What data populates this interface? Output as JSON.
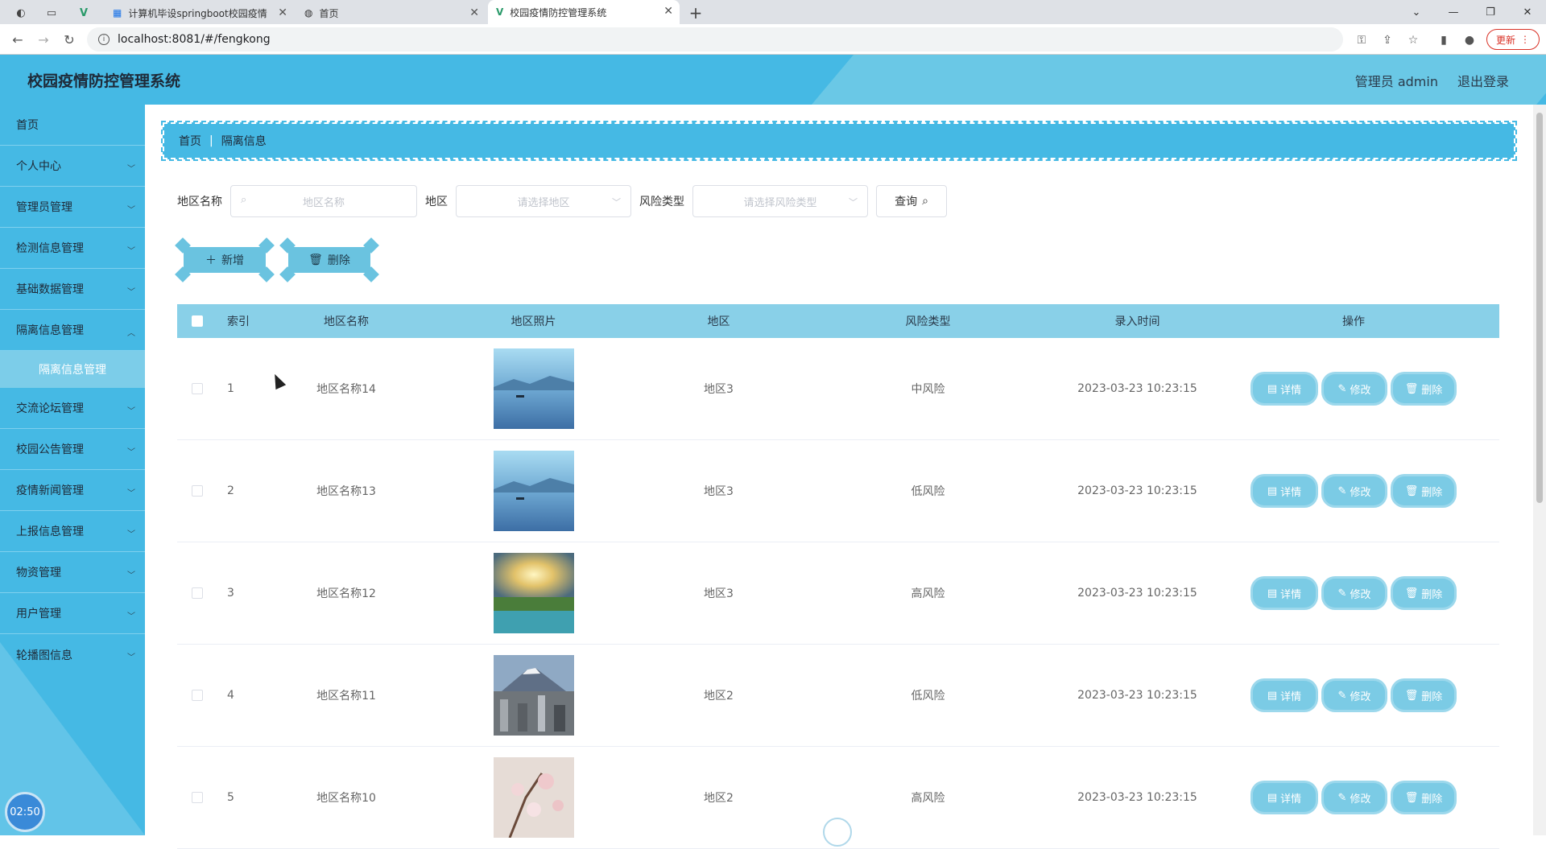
{
  "browser": {
    "tabs": [
      {
        "label": "计算机毕设springboot校园疫情",
        "icon": "calendar-icon"
      },
      {
        "label": "首页",
        "icon": "globe-icon"
      },
      {
        "label": "校园疫情防控管理系统",
        "icon": "vue-icon"
      }
    ],
    "url": "localhost:8081/#/fengkong",
    "update_label": "更新"
  },
  "header": {
    "title": "校园疫情防控管理系统",
    "user": "管理员 admin",
    "logout": "退出登录"
  },
  "sidebar": {
    "items": [
      {
        "label": "首页"
      },
      {
        "label": "个人中心"
      },
      {
        "label": "管理员管理"
      },
      {
        "label": "检测信息管理"
      },
      {
        "label": "基础数据管理"
      },
      {
        "label": "隔离信息管理"
      },
      {
        "label": "交流论坛管理"
      },
      {
        "label": "校园公告管理"
      },
      {
        "label": "疫情新闻管理"
      },
      {
        "label": "上报信息管理"
      },
      {
        "label": "物资管理"
      },
      {
        "label": "用户管理"
      },
      {
        "label": "轮播图信息"
      }
    ],
    "sub_active": "隔离信息管理",
    "clock": "02:50"
  },
  "breadcrumb": {
    "home": "首页",
    "current": "隔离信息"
  },
  "search": {
    "name_label": "地区名称",
    "name_placeholder": "地区名称",
    "region_label": "地区",
    "region_placeholder": "请选择地区",
    "risk_label": "风险类型",
    "risk_placeholder": "请选择风险类型",
    "query_label": "查询"
  },
  "actions": {
    "add": "新增",
    "delete": "删除"
  },
  "table": {
    "headers": [
      "索引",
      "地区名称",
      "地区照片",
      "地区",
      "风险类型",
      "录入时间",
      "操作"
    ],
    "ops": {
      "detail": "详情",
      "edit": "修改",
      "delete": "删除"
    },
    "rows": [
      {
        "idx": "1",
        "name": "地区名称14",
        "region": "地区3",
        "risk": "中风险",
        "time": "2023-03-23 10:23:15",
        "photo": "lake-boat"
      },
      {
        "idx": "2",
        "name": "地区名称13",
        "region": "地区3",
        "risk": "低风险",
        "time": "2023-03-23 10:23:15",
        "photo": "lake-boat"
      },
      {
        "idx": "3",
        "name": "地区名称12",
        "region": "地区3",
        "risk": "高风险",
        "time": "2023-03-23 10:23:15",
        "photo": "sunset-lake"
      },
      {
        "idx": "4",
        "name": "地区名称11",
        "region": "地区2",
        "risk": "低风险",
        "time": "2023-03-23 10:23:15",
        "photo": "city-mountain"
      },
      {
        "idx": "5",
        "name": "地区名称10",
        "region": "地区2",
        "risk": "高风险",
        "time": "2023-03-23 10:23:15",
        "photo": "blossom"
      }
    ]
  },
  "colors": {
    "primary": "#45b9e4",
    "header_row": "#89d0e8",
    "button": "#7bcbe5"
  }
}
